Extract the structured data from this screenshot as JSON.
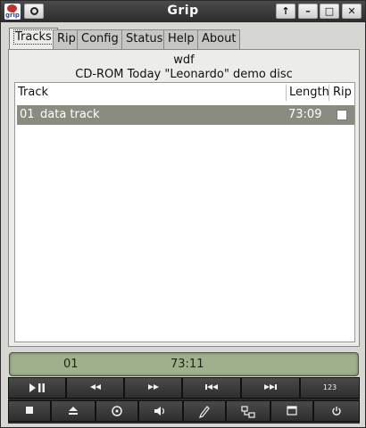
{
  "window": {
    "title": "Grip"
  },
  "titlebar": {
    "app_icon_text": "grip",
    "window_buttons": [
      "↑",
      "–",
      "□",
      "✕"
    ]
  },
  "tabs": [
    {
      "label": "Tracks",
      "active": true
    },
    {
      "label": "Rip",
      "active": false
    },
    {
      "label": "Config",
      "active": false
    },
    {
      "label": "Status",
      "active": false
    },
    {
      "label": "Help",
      "active": false
    },
    {
      "label": "About",
      "active": false
    }
  ],
  "disc": {
    "artist": "wdf",
    "title": "CD-ROM Today \"Leonardo\" demo disc"
  },
  "track_list": {
    "columns": {
      "track": "Track",
      "length": "Length",
      "rip": "Rip"
    },
    "rows": [
      {
        "number": "01",
        "name": "data track",
        "length": "73:09",
        "rip": false,
        "selected": true
      }
    ]
  },
  "display": {
    "track": "01",
    "time": "73:11"
  },
  "controls": {
    "row1": [
      "play-pause-icon",
      "rewind-icon",
      "fast-forward-icon",
      "previous-track-icon",
      "next-track-icon",
      "123"
    ],
    "row2": [
      "stop-icon",
      "eject-icon",
      "cd-icon",
      "volume-icon",
      "edit-icon",
      "network-icon",
      "window-icon",
      "power-icon"
    ],
    "mode_label": "1 2 3"
  },
  "colors": {
    "selected_row": "#8a8c80",
    "display_bg": "#9fb08c",
    "titlebar": "#3a3a3a"
  }
}
